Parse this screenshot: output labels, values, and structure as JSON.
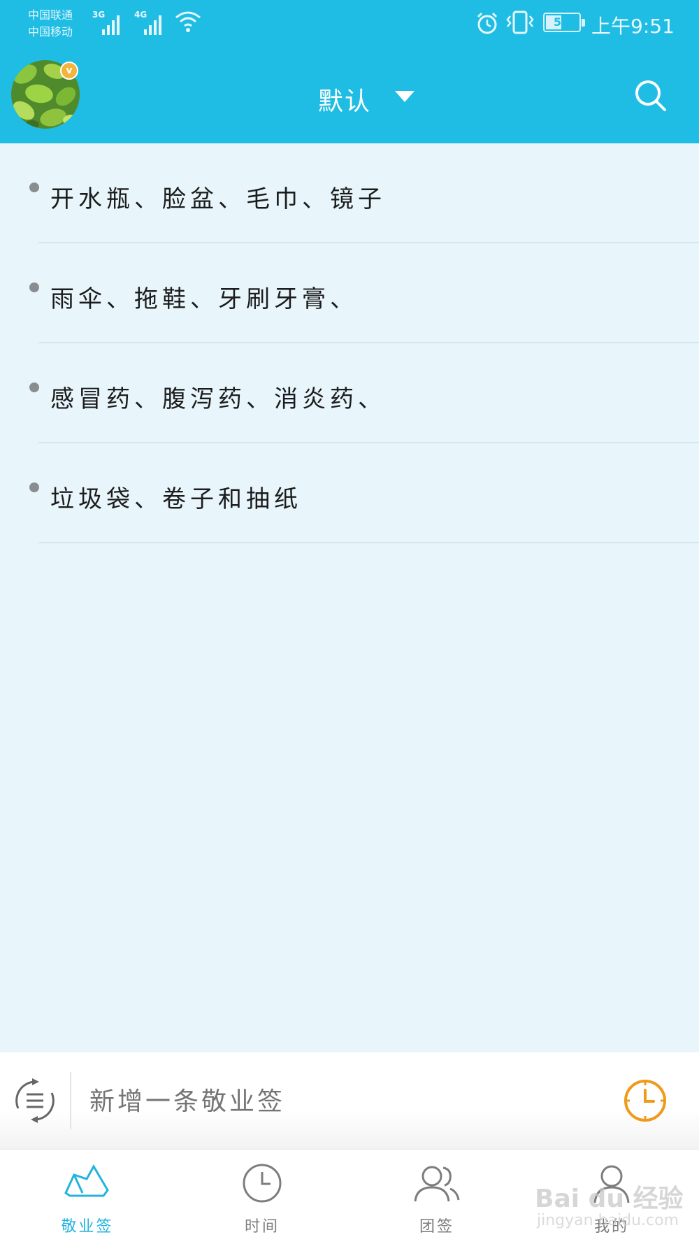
{
  "status_bar": {
    "carrier1": "中国联通",
    "carrier2": "中国移动",
    "net1": "3G",
    "net2": "4G",
    "battery": "51",
    "time": "上午9:51"
  },
  "header": {
    "title": "默认",
    "accent_color": "#1fbde3"
  },
  "notes": [
    {
      "text": "开水瓶、脸盆、毛巾、镜子"
    },
    {
      "text": "雨伞、拖鞋、牙刷牙膏、"
    },
    {
      "text": "感冒药、腹泻药、消炎药、"
    },
    {
      "text": "垃圾袋、卷子和抽纸"
    }
  ],
  "composer": {
    "placeholder": "新增一条敬业签",
    "reminder_color": "#f09a1a"
  },
  "nav": {
    "tabs": [
      {
        "label": "敬业签",
        "icon": "note-icon",
        "active": true
      },
      {
        "label": "时间",
        "icon": "clock-icon",
        "active": false
      },
      {
        "label": "团签",
        "icon": "team-icon",
        "active": false
      },
      {
        "label": "我的",
        "icon": "user-icon",
        "active": false
      }
    ],
    "active_color": "#23b3df"
  },
  "watermark": {
    "brand": "Bai du 经验",
    "url": "jingyan.baidu.com"
  }
}
